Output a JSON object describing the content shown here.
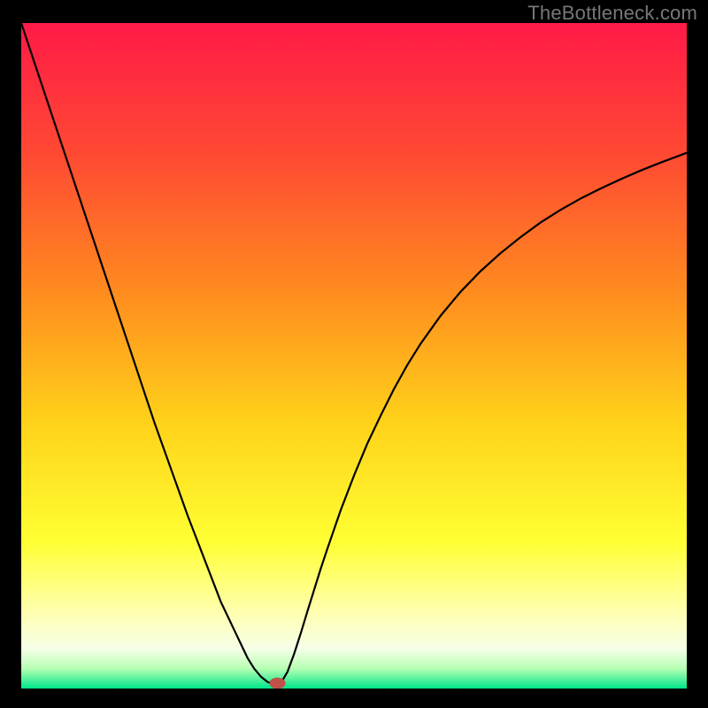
{
  "watermark": "TheBottleneck.com",
  "chart_data": {
    "type": "line",
    "title": "",
    "xlabel": "",
    "ylabel": "",
    "xlim": [
      0,
      100
    ],
    "ylim": [
      0,
      100
    ],
    "grid": false,
    "legend": false,
    "gradient_stops": [
      {
        "offset": 0.0,
        "color": "#ff1a47"
      },
      {
        "offset": 0.2,
        "color": "#ff4a33"
      },
      {
        "offset": 0.4,
        "color": "#ff8a1f"
      },
      {
        "offset": 0.6,
        "color": "#ffd21a"
      },
      {
        "offset": 0.78,
        "color": "#ffff33"
      },
      {
        "offset": 0.88,
        "color": "#ffffaa"
      },
      {
        "offset": 0.94,
        "color": "#f6ffe8"
      },
      {
        "offset": 0.97,
        "color": "#b6ffb3"
      },
      {
        "offset": 1.0,
        "color": "#00e58a"
      }
    ],
    "marker": {
      "x": 38.5,
      "y": 0.8,
      "color": "#c05048",
      "rx": 1.2,
      "ry": 0.85
    },
    "series": [
      {
        "name": "bottleneck-curve",
        "x": [
          0,
          1,
          2,
          3,
          4,
          5,
          6,
          7,
          8,
          9,
          10,
          11,
          12,
          13,
          14,
          15,
          16,
          17,
          18,
          19,
          20,
          21,
          22,
          23,
          24,
          25,
          26,
          27,
          28,
          29,
          30,
          31,
          32,
          33,
          34,
          35,
          36,
          37,
          38,
          38.5,
          39,
          40,
          41,
          42,
          43,
          44,
          45,
          46,
          48,
          50,
          52,
          54,
          56,
          58,
          60,
          63,
          66,
          69,
          72,
          75,
          78,
          81,
          84,
          87,
          90,
          93,
          96,
          100
        ],
        "y": [
          100,
          97,
          94,
          91,
          88,
          85,
          82,
          79,
          76,
          73,
          70,
          67,
          64,
          61,
          58,
          55,
          52,
          49,
          46,
          43,
          40,
          37.2,
          34.4,
          31.6,
          28.8,
          26,
          23.4,
          20.8,
          18.2,
          15.6,
          13,
          10.9,
          8.8,
          6.7,
          4.6,
          3,
          1.8,
          1,
          0.6,
          0.4,
          0.8,
          2.5,
          5.2,
          8.3,
          11.6,
          14.8,
          18,
          21,
          26.8,
          32,
          36.8,
          41,
          45,
          48.6,
          51.8,
          56,
          59.6,
          62.7,
          65.4,
          67.8,
          70,
          71.9,
          73.6,
          75.1,
          76.5,
          77.8,
          79,
          80.5
        ]
      }
    ]
  }
}
